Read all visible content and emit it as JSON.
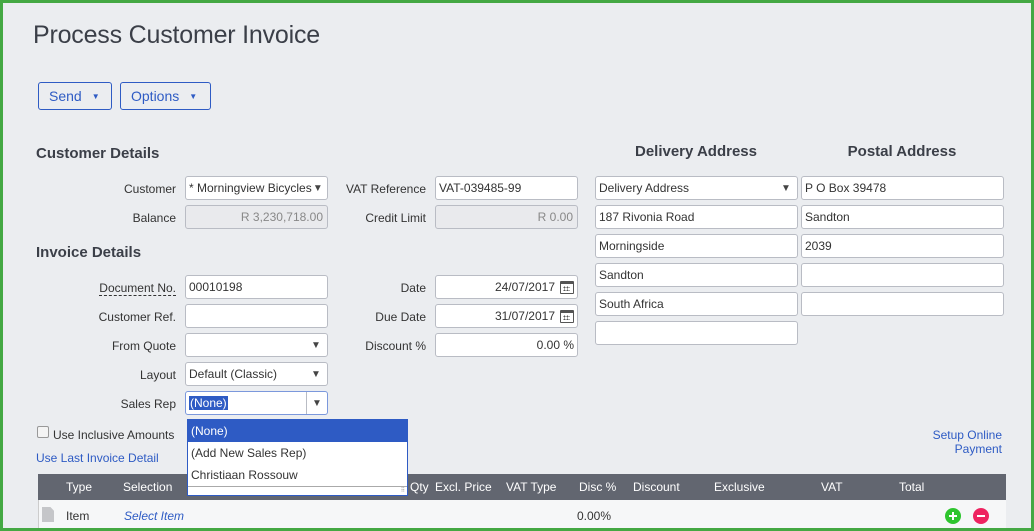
{
  "page": {
    "title": "Process Customer Invoice"
  },
  "toolbar": {
    "send_label": "Send",
    "options_label": "Options",
    "caret": "▼"
  },
  "customer_details": {
    "heading": "Customer Details",
    "customer_label": "Customer",
    "customer_value": "* Morningview Bicycles",
    "balance_label": "Balance",
    "balance_value": "R 3,230,718.00",
    "vat_ref_label": "VAT Reference",
    "vat_ref_value": "VAT-039485-99",
    "credit_limit_label": "Credit Limit",
    "credit_limit_value": "R 0.00"
  },
  "invoice_details": {
    "heading": "Invoice Details",
    "doc_no_label": "Document No.",
    "doc_no_value": "00010198",
    "customer_ref_label": "Customer Ref.",
    "customer_ref_value": "",
    "from_quote_label": "From Quote",
    "from_quote_value": "",
    "layout_label": "Layout",
    "layout_value": "Default (Classic)",
    "sales_rep_label": "Sales Rep",
    "sales_rep_value": "(None)",
    "date_label": "Date",
    "date_value": "24/07/2017",
    "due_date_label": "Due Date",
    "due_date_value": "31/07/2017",
    "discount_label": "Discount %",
    "discount_value": "0.00 %"
  },
  "sales_rep_dropdown": {
    "options": [
      "(None)",
      "(Add New Sales Rep)",
      "Christiaan Rossouw"
    ],
    "selected": "(None)"
  },
  "delivery_address": {
    "heading": "Delivery Address",
    "select_value": "Delivery Address",
    "lines": [
      "187 Rivonia Road",
      "Morningside",
      "Sandton",
      "South Africa",
      ""
    ]
  },
  "postal_address": {
    "heading": "Postal Address",
    "lines": [
      "P O Box 39478",
      "Sandton",
      "2039",
      "",
      ""
    ]
  },
  "options": {
    "inclusive_label": "Use Inclusive Amounts",
    "inclusive_checked": false,
    "last_invoice_link": "Use Last Invoice Detail",
    "online_payment_link": "Setup Online Payment"
  },
  "lines_table": {
    "headers": [
      "Type",
      "Selection",
      "Qty",
      "Excl. Price",
      "VAT Type",
      "Disc %",
      "Discount",
      "Exclusive",
      "VAT",
      "Total"
    ],
    "rows": [
      {
        "type": "Item",
        "selection": "Select Item",
        "disc_pct": "0.00%"
      }
    ]
  }
}
